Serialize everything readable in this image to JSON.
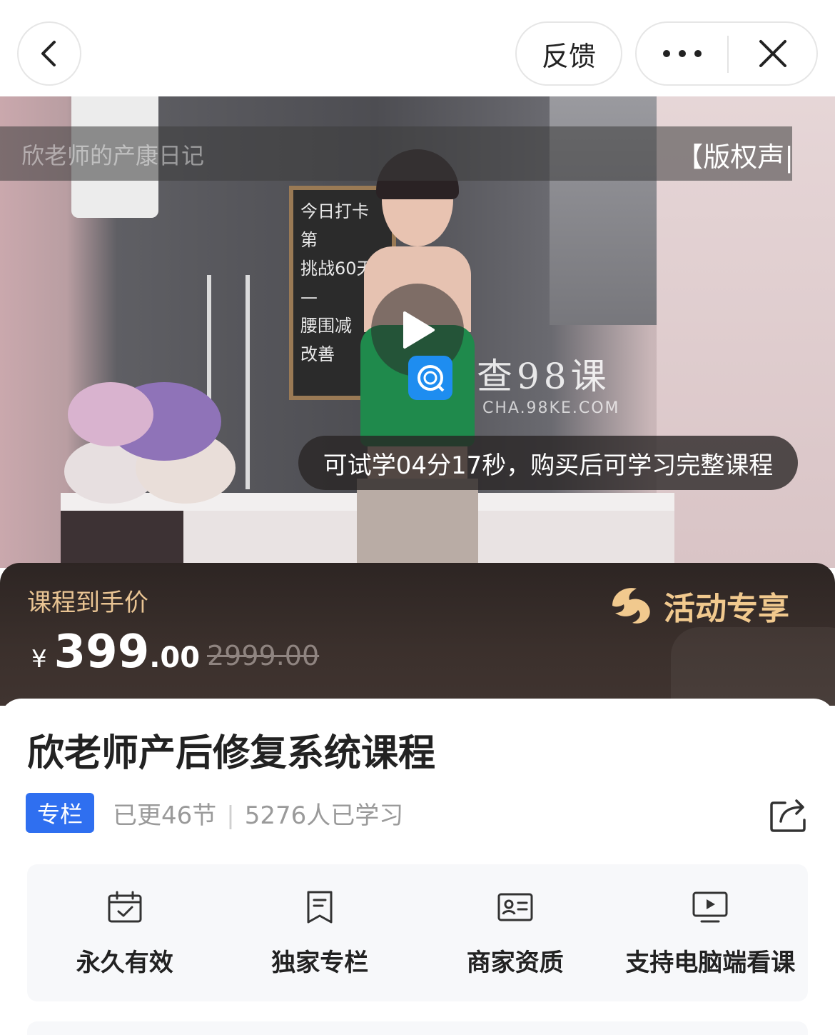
{
  "topbar": {
    "back_icon": "chevron-left-icon",
    "feedback_label": "反馈",
    "more_icon": "more-dots-icon",
    "close_icon": "close-icon"
  },
  "video": {
    "watermark": "欣老师的产康日记",
    "copyright": "【版权声|",
    "board_lines": [
      "今日打卡第",
      "挑战60天—",
      "腰围减",
      "改善"
    ],
    "play_icon": "play-icon",
    "site_logo_icon": "site-logo-icon",
    "site_name": "查98课",
    "site_url": "CHA.98KE.COM",
    "trial_notice": "可试学04分17秒，购买后可学习完整课程"
  },
  "price": {
    "label": "课程到手价",
    "currency": "¥",
    "integer": "399",
    "decimal": ".00",
    "original": "2999.00",
    "promo_icon": "promo-logo-icon",
    "promo_text": "活动专享",
    "accent_color": "#e9c493"
  },
  "course": {
    "title": "欣老师产后修复系统课程",
    "tag": "专栏",
    "updated": "已更46节",
    "separator": "|",
    "learners": "5276人已学习",
    "share_icon": "share-icon",
    "tag_color": "#2f6ff0"
  },
  "features": [
    {
      "icon": "calendar-check-icon",
      "label": "永久有效"
    },
    {
      "icon": "bookmark-icon",
      "label": "独家专栏"
    },
    {
      "icon": "id-card-icon",
      "label": "商家资质"
    },
    {
      "icon": "monitor-play-icon",
      "label": "支持电脑端看课"
    }
  ]
}
